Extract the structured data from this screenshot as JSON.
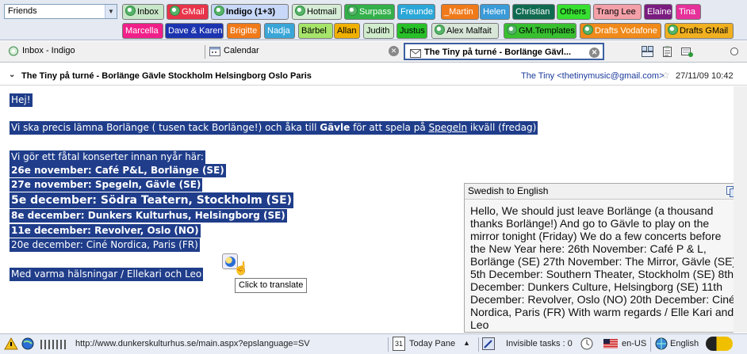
{
  "folder_select": {
    "value": "Friends"
  },
  "toolbar_tabs": [
    {
      "label": "Inbox",
      "bg": "#c8e6c8",
      "icon": true
    },
    {
      "label": "GMail",
      "bg": "#e8344a",
      "color": "#fff",
      "icon": true
    },
    {
      "label": "Indigo (1+3)",
      "bg": "#c8d8f8",
      "icon": true,
      "bold": true
    },
    {
      "label": "Hotmail",
      "bg": "#d6ecd6",
      "icon": true
    },
    {
      "label": "Surpass",
      "bg": "#33b04a",
      "color": "#fff",
      "icon": true
    },
    {
      "label": "Freunde",
      "bg": "#2aa7d8",
      "color": "#fff"
    },
    {
      "label": "_Martin",
      "bg": "#f07a1a",
      "color": "#fff"
    },
    {
      "label": "Helen",
      "bg": "#3a9bd8",
      "color": "#fff"
    },
    {
      "label": "Christian",
      "bg": "#0f6b50",
      "color": "#fff"
    },
    {
      "label": "Others",
      "bg": "#36e030"
    },
    {
      "label": "Trang Lee",
      "bg": "#f4a0a8"
    },
    {
      "label": "Elaine",
      "bg": "#7a1c80",
      "color": "#fff"
    },
    {
      "label": "Tina",
      "bg": "#e6309a",
      "color": "#fff"
    },
    {
      "label": "Marcella",
      "bg": "#f0208a",
      "color": "#fff"
    },
    {
      "label": "Dave & Karen",
      "bg": "#1c34b0",
      "color": "#fff"
    },
    {
      "label": "Brigitte",
      "bg": "#f07a1a",
      "color": "#fff"
    },
    {
      "label": "Nadja",
      "bg": "#3aa6d8",
      "color": "#fff"
    },
    {
      "label": "Bärbel",
      "bg": "#a6e46a"
    },
    {
      "label": "Allan",
      "bg": "#f0b000"
    },
    {
      "label": "Judith",
      "bg": "#d0eccc"
    },
    {
      "label": "Justus",
      "bg": "#28c028"
    },
    {
      "label": "Alex Malfait",
      "bg": "#d8e6d8",
      "icon": true
    },
    {
      "label": "GM.Templates",
      "bg": "#38c030",
      "icon": true
    },
    {
      "label": "Drafts Vodafone",
      "bg": "#f08a1a",
      "color": "#fff",
      "icon": true
    },
    {
      "label": "Drafts GMail",
      "bg": "#f0b020",
      "icon": true
    }
  ],
  "pane_tabs": [
    {
      "label": "Inbox - Indigo"
    },
    {
      "label": "Calendar"
    },
    {
      "label": "The Tiny på turné - Borlänge Gävl..."
    }
  ],
  "message": {
    "subject": "The Tiny på turné - Borlänge Gävle Stockholm Helsingborg Oslo Paris",
    "sender": "The Tiny <thetinymusic@gmail.com>",
    "date": "27/11/09 10:42",
    "greeting": "Hej!",
    "line1_a": "Vi ska precis lämna Borlänge ( tusen tack Borlänge!) och åka till ",
    "line1_b": "Gävle",
    "line1_c": " för att spela på ",
    "line1_d": "Spegeln",
    "line1_e": " ikväll (fredag)",
    "line2": "Vi gör ett fåtal konserter innan nyår här:",
    "dates": [
      "26e november:  Café P&L, Borlänge (SE)",
      "27e november: Spegeln, Gävle (SE)",
      "5e december:  Södra Teatern, Stockholm (SE)",
      "8e december: Dunkers Kulturhus, Helsingborg (SE)",
      "11e december:  Revolver, Oslo (NO)",
      "20e december:  Ciné Nordica, Paris (FR)"
    ],
    "signoff": "Med varma hälsningar / Ellekari och Leo"
  },
  "tooltip": "Click to translate",
  "translation": {
    "title": "Swedish to English",
    "text": "Hello, We should just leave Borlänge (a thousand thanks Borlänge!) And go to Gävle to play on the mirror tonight (Friday) We do a few concerts before the New Year here: 26th November: Café P & L, Borlänge (SE) 27th November: The Mirror, Gävle (SE) 5th December: Southern Theater, Stockholm (SE) 8th December: Dunkers Culture, Helsingborg (SE) 11th December: Revolver, Oslo (NO) 20th December: Ciné Nordica, Paris (FR) With warm regards / Elle Kari and Leo"
  },
  "status": {
    "url": "http://www.dunkerskulturhus.se/main.aspx?epslanguage=SV",
    "calendar_day": "31",
    "today_pane": "Today Pane",
    "invisible_tasks": "Invisible tasks : 0",
    "locale": "en-US",
    "language": "English"
  },
  "icons": {
    "tab_icon": "mail-folder-icon",
    "pane_calendar": "calendar-icon",
    "pane_message": "envelope-icon",
    "star": "star-icon",
    "copy": "copy-icon",
    "globe": "globe-translate-icon"
  }
}
